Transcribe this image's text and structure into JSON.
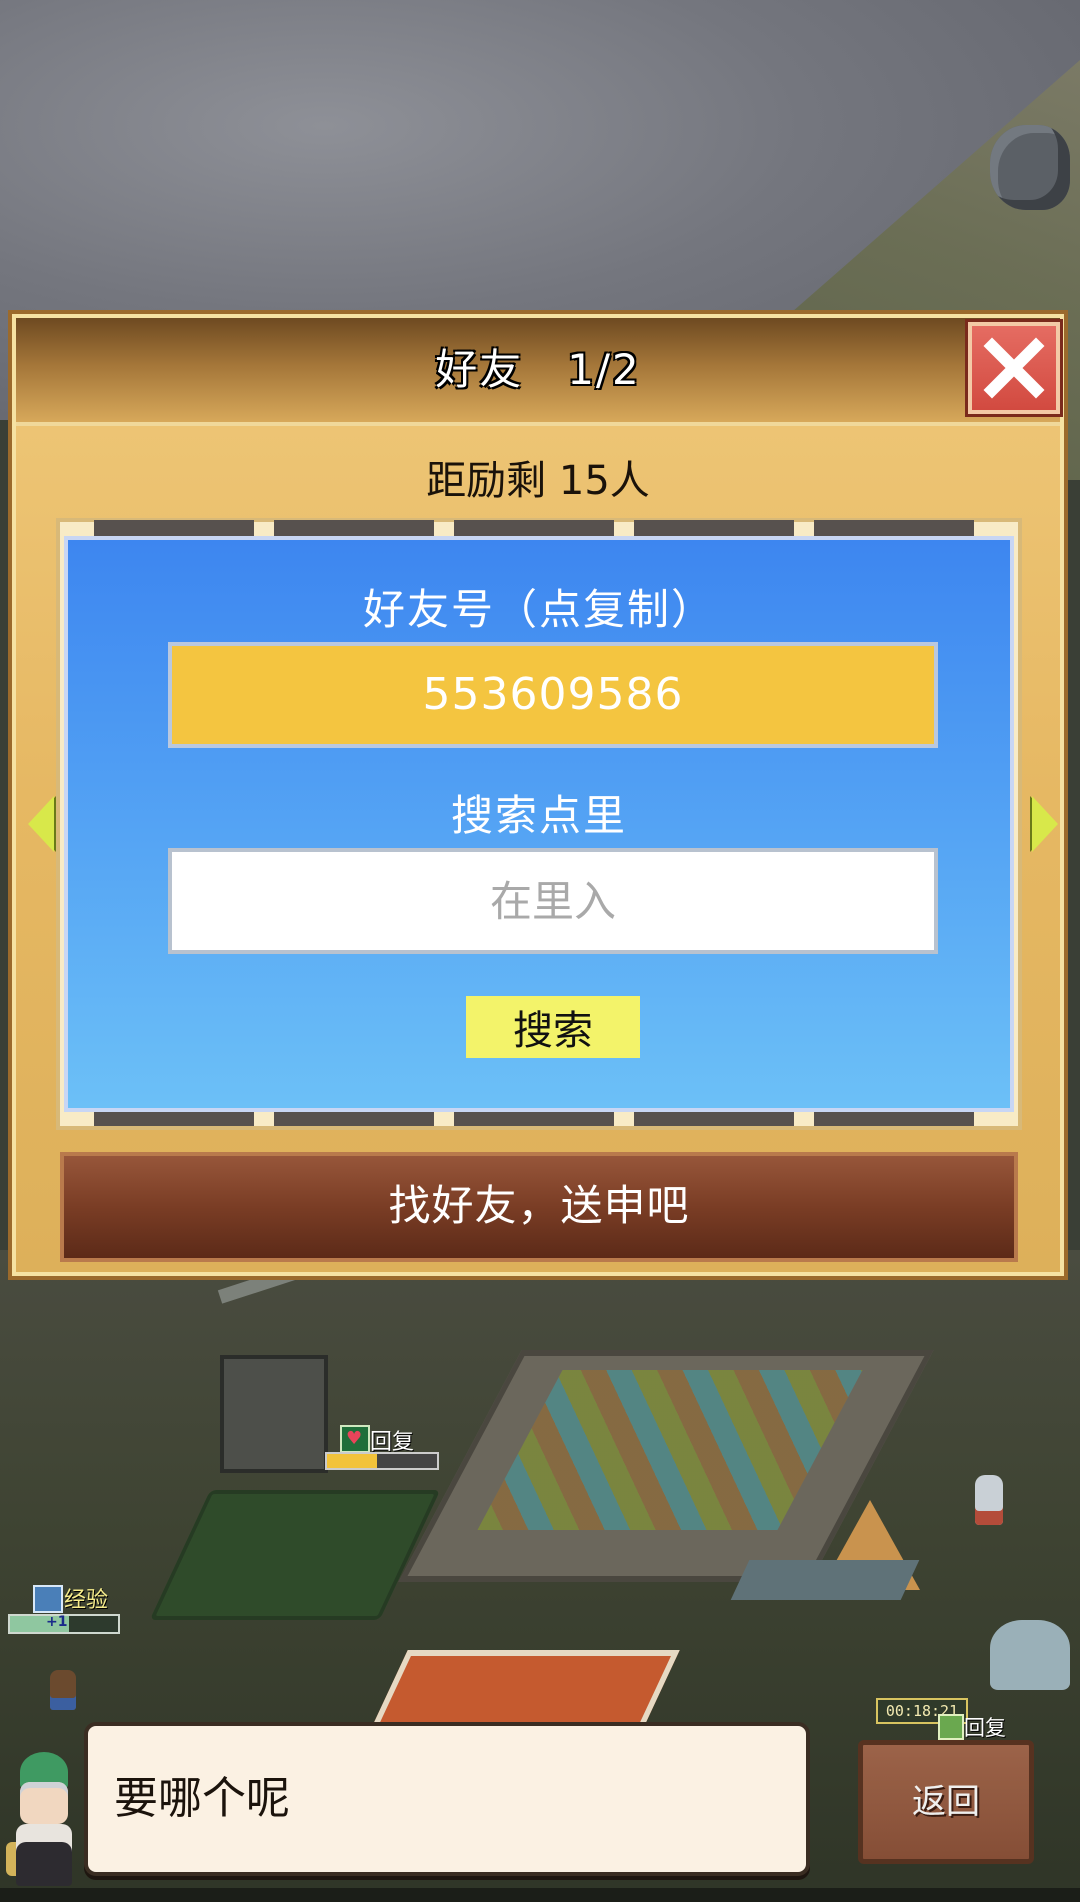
{
  "dialog": {
    "title": "好友　1/2",
    "subtitle": "距励剩 15人",
    "friend_id_label": "好友号（点复制）",
    "friend_id_value": "553609586",
    "search_label": "搜索点里",
    "search_placeholder": "在里入",
    "search_button": "搜索",
    "invite_button": "找好友，送申吧"
  },
  "hud": {
    "hp_label": "回复",
    "hp_progress": 0.45,
    "exp_label": "经验",
    "exp_badge": "+1",
    "exp_progress": 0.55,
    "timer": "00:18:21",
    "return_mini_label": "回复"
  },
  "message": {
    "text": "要哪个呢",
    "return_button": "返回"
  },
  "colors": {
    "panel_blue": "#4f9df3",
    "id_box_yellow": "#f4c540",
    "invite_brown": "#7a3d25",
    "close_red": "#d24a40",
    "search_button_yellow": "#f3f36a"
  },
  "icons": [
    "close-icon",
    "arrow-left-icon",
    "arrow-right-icon",
    "heart-icon",
    "shovel-icon"
  ]
}
